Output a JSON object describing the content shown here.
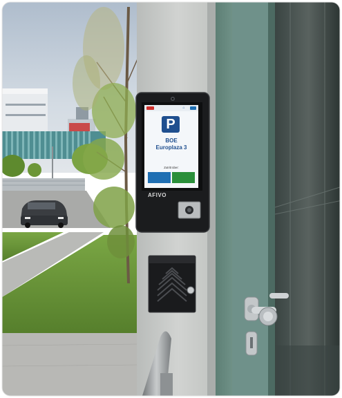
{
  "scene": {
    "type": "photo",
    "subject": "parking-kiosk-on-pillar",
    "colors": {
      "sky": "#c9d4de",
      "grass": "#6c9a3a",
      "pillar": "#c9cbc9",
      "kiosk_body": "#1b1c1e",
      "door_frame": "#6d8f84",
      "glass": "#2b3634"
    }
  },
  "kiosk": {
    "brand": "AFIVO",
    "screen": {
      "lang_label": "",
      "help_label": "",
      "icon": "parking-icon",
      "p_label": "P",
      "title_line1": "BOE",
      "title_line2": "Europlaza 3",
      "access_label": "Zutritt über:",
      "btn1_label": "",
      "btn2_label": ""
    }
  },
  "intercom": {
    "icon": "speaker-grille-icon"
  }
}
